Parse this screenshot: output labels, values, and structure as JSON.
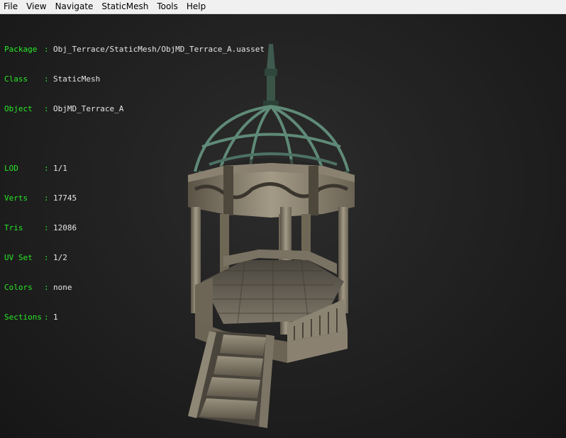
{
  "menu": [
    "File",
    "View",
    "Navigate",
    "StaticMesh",
    "Tools",
    "Help"
  ],
  "info": {
    "package": {
      "key": "Package",
      "value": "Obj_Terrace/StaticMesh/ObjMD_Terrace_A.uasset"
    },
    "class": {
      "key": "Class",
      "value": "StaticMesh"
    },
    "object": {
      "key": "Object",
      "value": "ObjMD_Terrace_A"
    },
    "lod": {
      "key": "LOD",
      "value": "1/1"
    },
    "verts": {
      "key": "Verts",
      "value": "17745"
    },
    "tris": {
      "key": "Tris",
      "value": "12086"
    },
    "uvset": {
      "key": "UV Set",
      "value": "1/2"
    },
    "colors": {
      "key": "Colors",
      "value": "none"
    },
    "sections": {
      "key": "Sections",
      "value": "1"
    }
  },
  "colors": {
    "label": "#27e627",
    "value": "#e6e6e6",
    "background": "#222222",
    "menubar": "#f0f0f0"
  }
}
